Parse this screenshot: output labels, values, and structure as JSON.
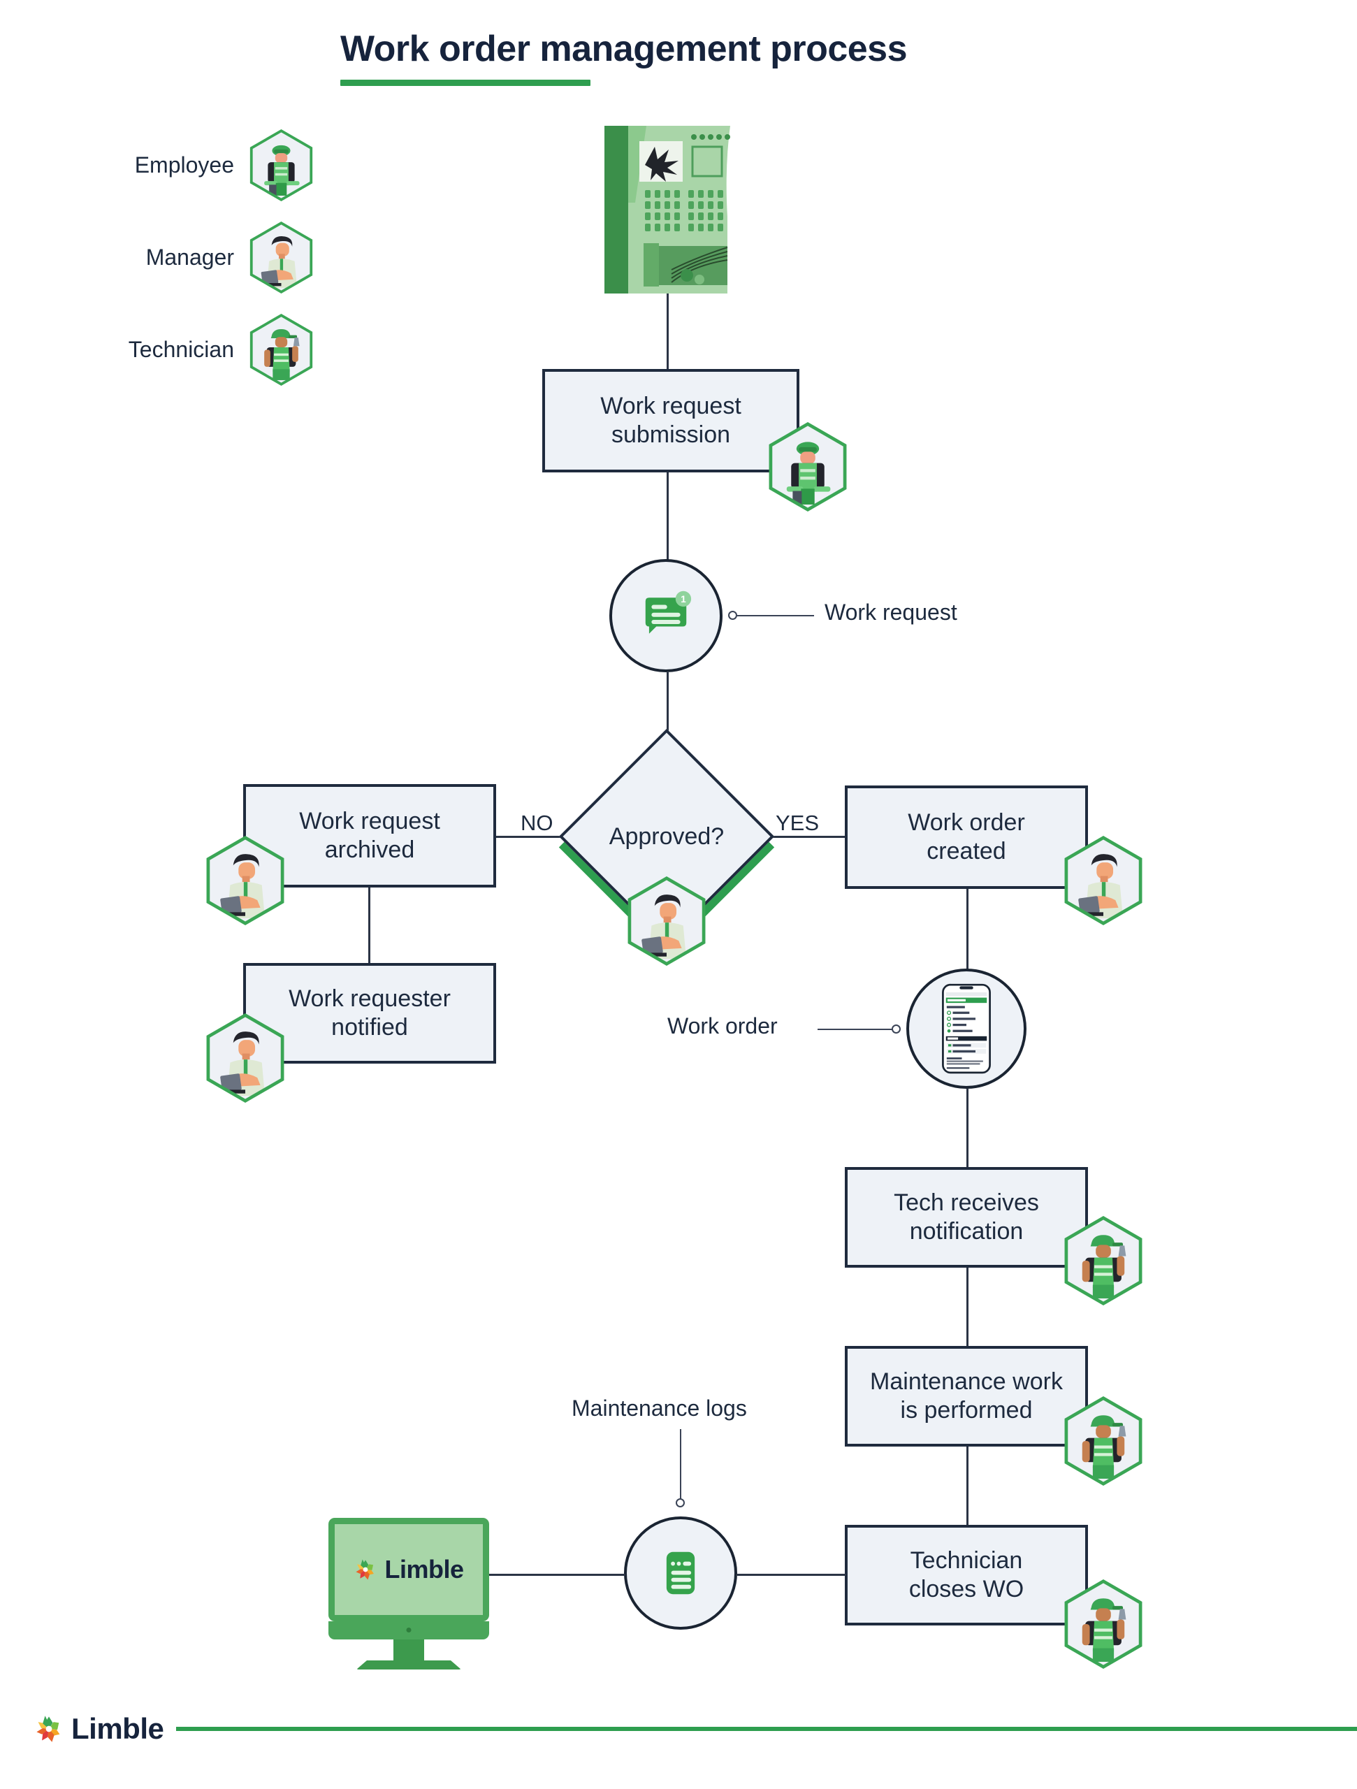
{
  "title": "Work order management process",
  "legend": {
    "items": [
      {
        "label": "Employee",
        "icon": "employee-avatar-icon"
      },
      {
        "label": "Manager",
        "icon": "manager-avatar-icon"
      },
      {
        "label": "Technician",
        "icon": "technician-avatar-icon"
      }
    ]
  },
  "illustrations": {
    "machine": "broken-machine-icon",
    "monitor_logo_text": "Limble",
    "monitor": "limble-desktop-monitor-icon"
  },
  "nodes": {
    "work_request_submission": "Work request\nsubmission",
    "work_request_submission_line1": "Work request",
    "work_request_submission_line2": "submission",
    "approved": "Approved?",
    "work_request_archived_line1": "Work request",
    "work_request_archived_line2": "archived",
    "work_requester_notified_line1": "Work requester",
    "work_requester_notified_line2": "notified",
    "work_order_created_line1": "Work order",
    "work_order_created_line2": "created",
    "tech_receives_notification_line1": "Tech receives",
    "tech_receives_notification_line2": "notification",
    "maintenance_work_performed_line1": "Maintenance work",
    "maintenance_work_performed_line2": "is performed",
    "technician_closes_wo_line1": "Technician",
    "technician_closes_wo_line2": "closes WO"
  },
  "branch_labels": {
    "no": "NO",
    "yes": "YES"
  },
  "annotations": {
    "work_request": "Work request",
    "work_order": "Work order",
    "maintenance_logs": "Maintenance logs"
  },
  "artifacts": {
    "work_request_icon": "chat-message-icon",
    "work_request_badge": "1",
    "work_order_icon": "mobile-work-order-icon",
    "maintenance_logs_icon": "document-log-icon"
  },
  "footer": {
    "brand": "Limble",
    "logo": "limble-pinwheel-logo-icon"
  },
  "colors": {
    "accent_green": "#2e9e4f",
    "dark_navy": "#1d2a3e",
    "box_fill": "#eef2f7",
    "box_border": "#1f2b3e"
  }
}
